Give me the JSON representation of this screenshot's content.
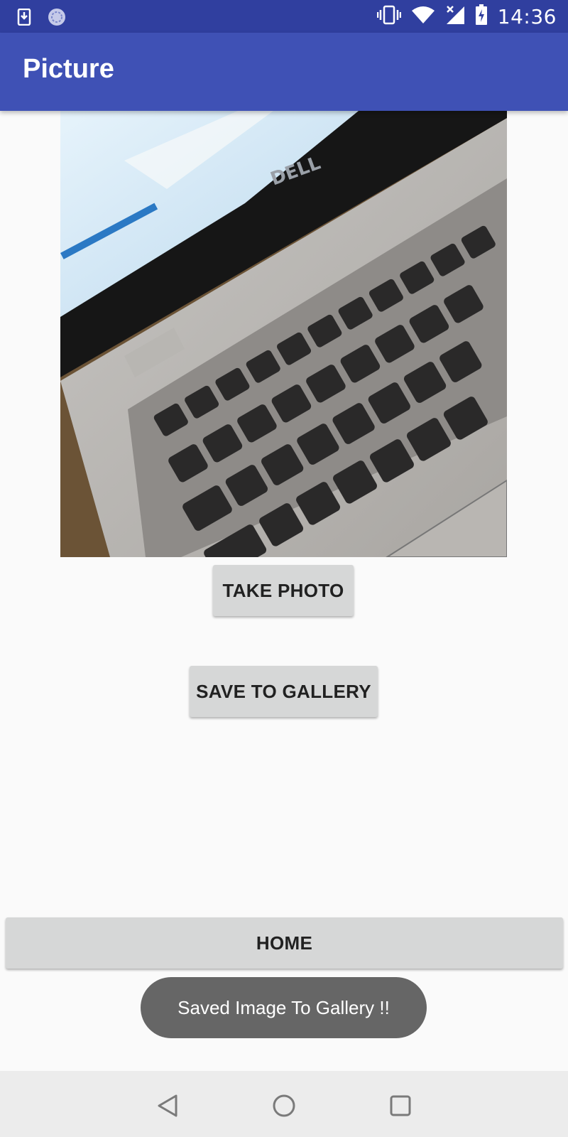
{
  "status_bar": {
    "time": "14:36",
    "icons": [
      "download-notification-icon",
      "sync-notification-icon",
      "vibrate-icon",
      "wifi-icon",
      "no-signal-icon",
      "battery-charging-icon"
    ]
  },
  "app_bar": {
    "title": "Picture"
  },
  "photo": {
    "description_icon": "captured-photo",
    "brand_text": "DELL"
  },
  "buttons": {
    "take_photo": "TAKE PHOTO",
    "save_to_gallery": "SAVE TO GALLERY",
    "home": "HOME"
  },
  "toast": {
    "message": "Saved Image To Gallery !!"
  },
  "nav_bar": {
    "icons": [
      "back-icon",
      "home-icon",
      "recents-icon"
    ]
  },
  "colors": {
    "status_bar": "#303f9f",
    "app_bar": "#3f51b5",
    "button": "#d6d7d7",
    "toast": "#666666",
    "background": "#fafafa"
  }
}
